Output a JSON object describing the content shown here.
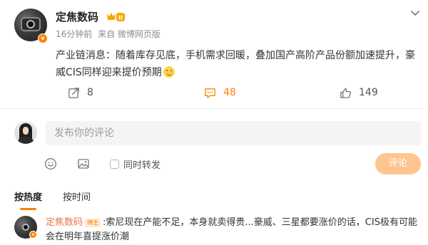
{
  "post": {
    "author": "定焦数码",
    "vip_text": "II",
    "verified_mark": "v",
    "time": "16分钟前",
    "source": "来自 微博网页版",
    "text": "产业链消息：随着库存见底，手机需求回暖，叠加国产高阶产品份额加速提升，豪威CIS同样迎来提价预期"
  },
  "actions": {
    "forward_count": "8",
    "comment_count": "48",
    "like_count": "149"
  },
  "composer": {
    "placeholder": "发布你的评论",
    "repost_label": "同时转发",
    "submit_label": "评论"
  },
  "sort": {
    "hot_label": "按热度",
    "time_label": "按时间"
  },
  "comments": [
    {
      "author": "定焦数码",
      "badge": "博主",
      "text": ":索尼现在产能不足，本身就卖得贵...豪威、三星都要涨价的话，CIS极有可能会在明年喜提涨价潮"
    }
  ],
  "colors": {
    "accent": "#ff8200",
    "author_link": "#eb7350",
    "submit_disabled": "#ffc590"
  },
  "icons": [
    "chevron-down-icon",
    "vip-badge-icon",
    "forward-icon",
    "comment-icon",
    "like-icon",
    "emoji-icon",
    "image-icon",
    "smile-emoji-icon"
  ]
}
